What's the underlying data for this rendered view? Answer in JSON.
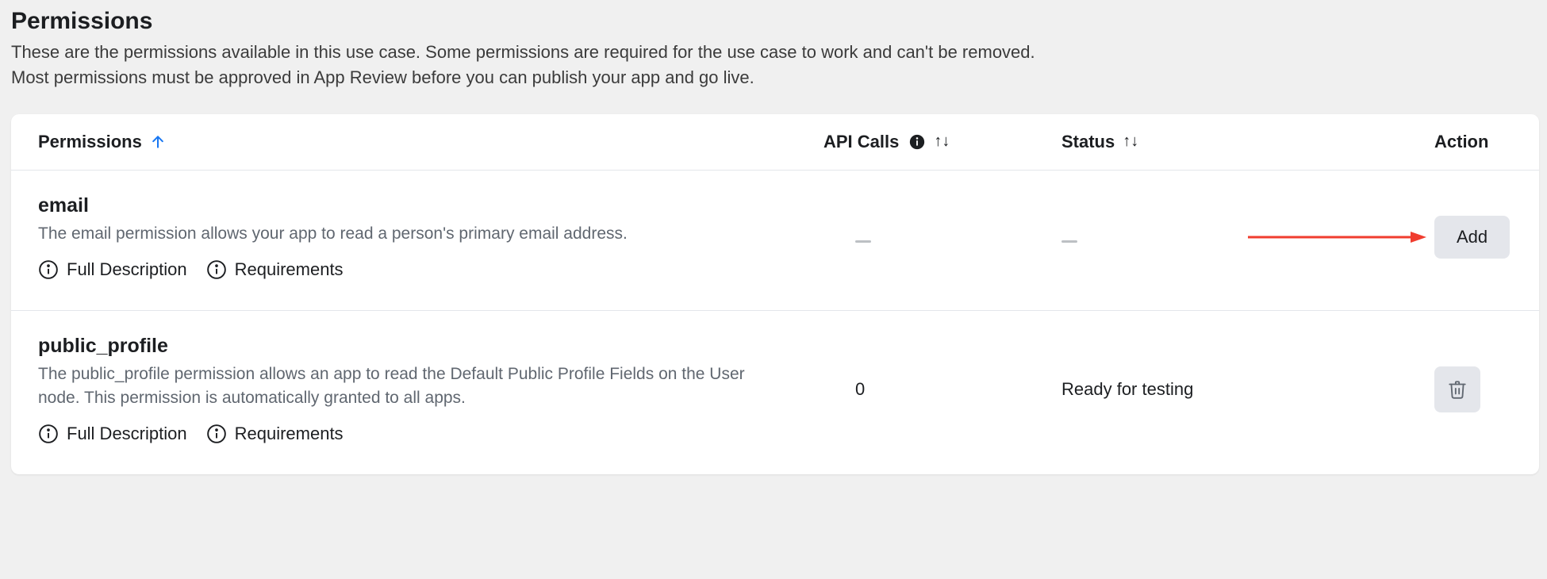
{
  "header": {
    "title": "Permissions",
    "description_line1": "These are the permissions available in this use case. Some permissions are required for the use case to work and can't be removed.",
    "description_line2": "Most permissions must be approved in App Review before you can publish your app and go live."
  },
  "table": {
    "columns": {
      "permissions": "Permissions",
      "api_calls": "API Calls",
      "status": "Status",
      "action": "Action"
    },
    "link_labels": {
      "full_description": "Full Description",
      "requirements": "Requirements"
    },
    "rows": [
      {
        "name": "email",
        "description": "The email permission allows your app to read a person's primary email address.",
        "api_calls": "—",
        "status": "—",
        "action_type": "add",
        "action_label": "Add"
      },
      {
        "name": "public_profile",
        "description": "The public_profile permission allows an app to read the Default Public Profile Fields on the User node. This permission is automatically granted to all apps.",
        "api_calls": "0",
        "status": "Ready for testing",
        "action_type": "delete",
        "action_label": ""
      }
    ]
  }
}
